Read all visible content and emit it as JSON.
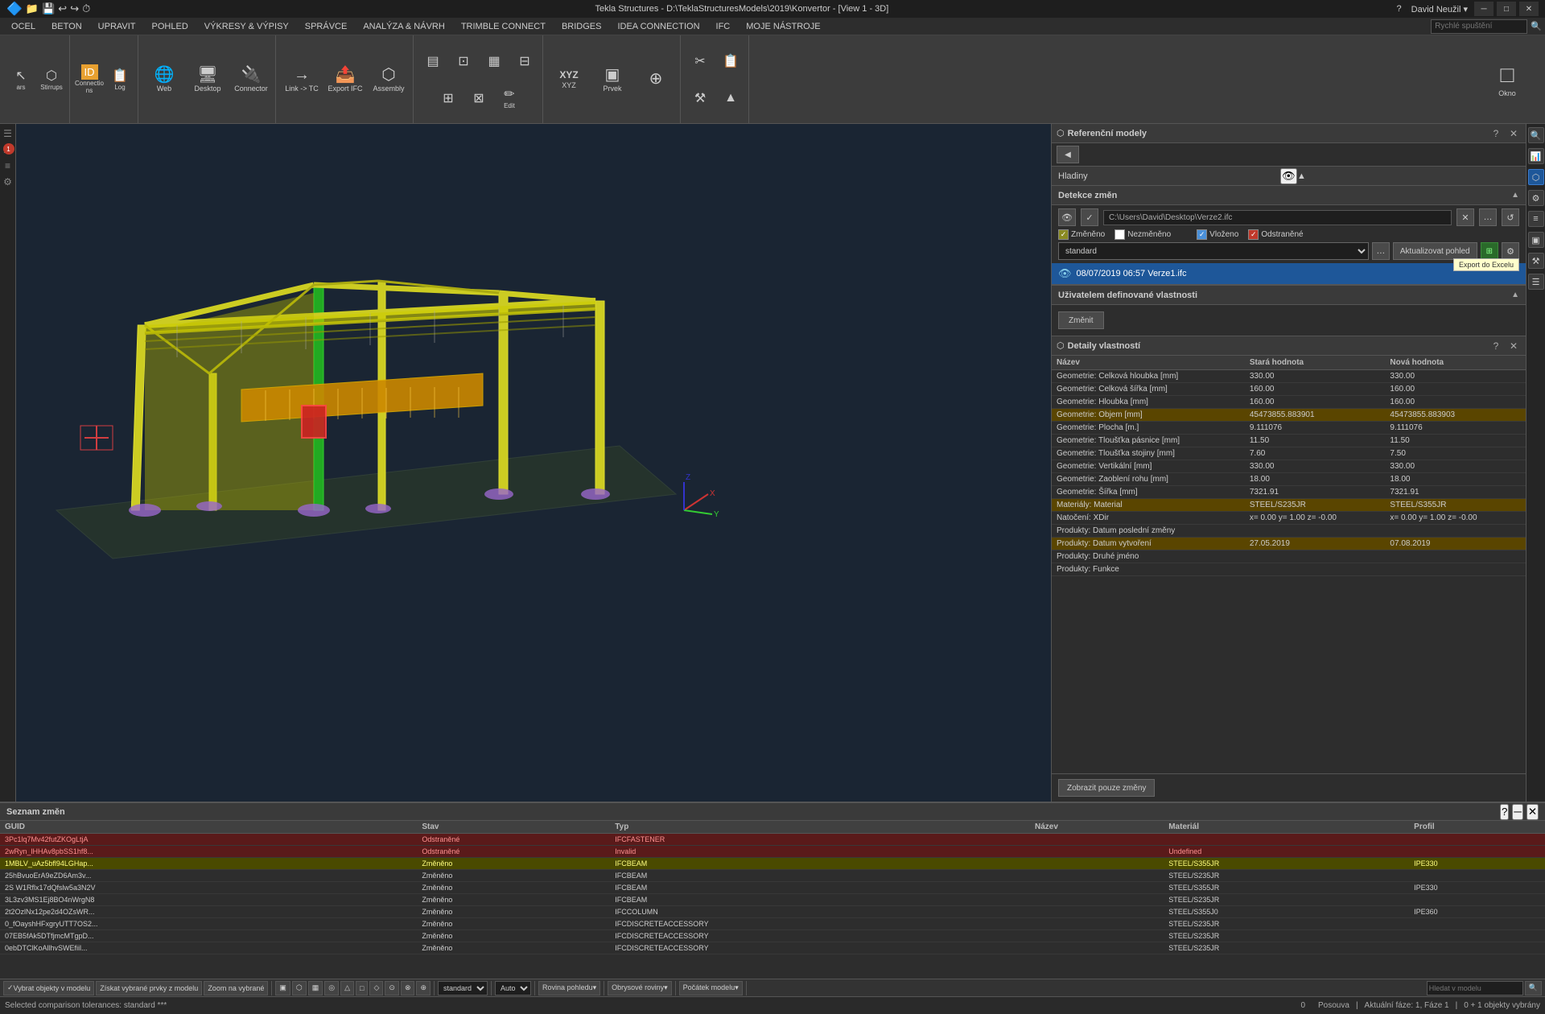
{
  "titlebar": {
    "title": "Tekla Structures - D:\\TeklaStructuresModels\\2019\\Konvertor - [View 1 - 3D]",
    "controls": [
      "?",
      "David Neužil ▾",
      "─",
      "□",
      "✕"
    ],
    "minimize": "─",
    "maximize": "□",
    "close": "✕"
  },
  "menubar": {
    "items": [
      "OCEL",
      "BETON",
      "UPRAVIT",
      "POHLED",
      "VÝKRESY & VÝPISY",
      "SPRÁVCE",
      "ANALÝZA & NÁVRH",
      "TRIMBLE CONNECT",
      "BRIDGES",
      "IDEA CONNECTION",
      "IFC",
      "MOJE NÁSTROJE"
    ]
  },
  "toolbar": {
    "groups": [
      {
        "tools": [
          {
            "icon": "↖",
            "label": "ars"
          },
          {
            "icon": "▣",
            "label": "Stirrups"
          }
        ]
      },
      {
        "tools": [
          {
            "icon": "ID",
            "label": "Connectio\nns"
          },
          {
            "icon": "📋",
            "label": "Log"
          }
        ]
      },
      {
        "tools": [
          {
            "icon": "🌐",
            "label": "Web"
          },
          {
            "icon": "🖥",
            "label": "Desktop"
          },
          {
            "icon": "🔌",
            "label": "Connector"
          }
        ]
      },
      {
        "tools": [
          {
            "icon": "→",
            "label": "Link -> TC"
          },
          {
            "icon": "📤",
            "label": "Export IFC"
          },
          {
            "icon": "⬡",
            "label": "Assembly"
          }
        ]
      },
      {
        "tools": [
          {
            "icon": "▤",
            "label": ""
          },
          {
            "icon": "⊡",
            "label": ""
          },
          {
            "icon": "⊞",
            "label": ""
          },
          {
            "icon": "⊟",
            "label": ""
          }
        ]
      },
      {
        "tools": [
          {
            "icon": "✏",
            "label": "Edit"
          }
        ]
      },
      {
        "tools": [
          {
            "icon": "XYZ",
            "label": "XYZ"
          },
          {
            "icon": "▣",
            "label": "Prvek"
          },
          {
            "icon": "⊕",
            "label": ""
          }
        ]
      }
    ],
    "rightTools": [
      "✂",
      "📋",
      "⚒",
      "▲"
    ]
  },
  "right_sidebar": {
    "buttons": [
      "?",
      "↗",
      "⚙",
      "👁",
      "⚙",
      "≡",
      "▣",
      "⚙"
    ]
  },
  "ref_models": {
    "title": "Referenční modely",
    "nav_btn": "◀",
    "hladiny": "Hladiny",
    "detection_title": "Detekce změn",
    "file_path": "C:\\Users\\David\\Desktop\\Verze2.ifc",
    "changed_label": "Změněno",
    "inserted_label": "Vloženo",
    "unchanged_label": "Nezměněno",
    "removed_label": "Odstraněné",
    "standard_option": "standard",
    "update_btn": "Aktualizovat pohled",
    "export_excel_tooltip": "Export do Excelu",
    "file_entry": "08/07/2019 06:57 Verze1.ifc",
    "user_props_title": "Uživatelem definované vlastnosti",
    "zmenit_btn": "Změnit"
  },
  "details": {
    "title": "Detaily vlastností",
    "columns": [
      "Název",
      "Stará hodnota",
      "Nová hodnota"
    ],
    "rows": [
      {
        "name": "Geometrie: Celková hloubka [mm]",
        "old": "330.00",
        "new": "330.00",
        "highlight": false
      },
      {
        "name": "Geometrie: Celková šířka [mm]",
        "old": "160.00",
        "new": "160.00",
        "highlight": false
      },
      {
        "name": "Geometrie: Hloubka [mm]",
        "old": "160.00",
        "new": "160.00",
        "highlight": false
      },
      {
        "name": "Geometrie: Objem [mm]",
        "old": "45473855.883901",
        "new": "45473855.883903",
        "highlight": true
      },
      {
        "name": "Geometrie: Plocha [m.]",
        "old": "9.111076",
        "new": "9.111076",
        "highlight": false
      },
      {
        "name": "Geometrie: Tloušťka pásnice [mm]",
        "old": "11.50",
        "new": "11.50",
        "highlight": false
      },
      {
        "name": "Geometrie: Tloušťka stojiny [mm]",
        "old": "7.60",
        "new": "7.50",
        "highlight": false
      },
      {
        "name": "Geometrie: Vertikální [mm]",
        "old": "330.00",
        "new": "330.00",
        "highlight": false
      },
      {
        "name": "Geometrie: Zaoblení rohu [mm]",
        "old": "18.00",
        "new": "18.00",
        "highlight": false
      },
      {
        "name": "Geometrie: Šířka [mm]",
        "old": "7321.91",
        "new": "7321.91",
        "highlight": false
      },
      {
        "name": "Materiály: Material",
        "old": "STEEL/S235JR",
        "new": "STEEL/S355JR",
        "highlight": true
      },
      {
        "name": "Natočení: XDir",
        "old": "x= 0.00 y= 1.00 z= -0.00",
        "new": "x= 0.00 y= 1.00 z= -0.00",
        "highlight": false
      },
      {
        "name": "Produkty: Datum poslední změny",
        "old": "",
        "new": "",
        "highlight": false
      },
      {
        "name": "Produkty: Datum vytvoření",
        "old": "27.05.2019",
        "new": "07.08.2019",
        "highlight": true
      },
      {
        "name": "Produkty: Druhé jméno",
        "old": "",
        "new": "",
        "highlight": false
      },
      {
        "name": "Produkty: Funkce",
        "old": "",
        "new": "",
        "highlight": false
      }
    ],
    "show_only_btn": "Zobrazit pouze změny"
  },
  "list": {
    "title": "Seznam změn",
    "columns": [
      "GUID",
      "Stav",
      "Typ",
      "Název",
      "Materiál",
      "Profil"
    ],
    "rows": [
      {
        "guid": "3Pc1lq7Mv42futZKOgLtjA",
        "stav": "Odstraněné",
        "typ": "IFCFASTENER",
        "nazev": "",
        "material": "",
        "profil": "",
        "row_class": "red-row"
      },
      {
        "guid": "2wRyn_lHHAv8pbSS1hf8...",
        "stav": "Odstraněné",
        "typ": "Invalid",
        "nazev": "",
        "material": "Undefined",
        "profil": "",
        "row_class": "red-row"
      },
      {
        "guid": "1MBLV_uAz5bfl94LGHap...",
        "stav": "Změněno",
        "typ": "IFCBEAM",
        "nazev": "",
        "material": "STEEL/S355JR",
        "profil": "IPE330",
        "row_class": "yellow-row"
      },
      {
        "guid": "25hBvuoErA9eZD6Am3v...",
        "stav": "Změněno",
        "typ": "IFCBEAM",
        "nazev": "",
        "material": "STEEL/S235JR",
        "profil": "",
        "row_class": ""
      },
      {
        "guid": "2S W1Rflx17dQfslw5a3N2V",
        "stav": "Změněno",
        "typ": "IFCBEAM",
        "nazev": "",
        "material": "STEEL/S355JR",
        "profil": "IPE330",
        "row_class": ""
      },
      {
        "guid": "3L3zv3MS1Ej8BO4nWrgN8",
        "stav": "Změněno",
        "typ": "IFCBEAM",
        "nazev": "",
        "material": "STEEL/S235JR",
        "profil": "",
        "row_class": ""
      },
      {
        "guid": "2t2OzlNx12pe2d4OZsWR...",
        "stav": "Změněno",
        "typ": "IFCCOLUMN",
        "nazev": "",
        "material": "STEEL/S355J0",
        "profil": "IPE360",
        "row_class": ""
      },
      {
        "guid": "0_fOayshHFxgryUTT7OS2...",
        "stav": "Změněno",
        "typ": "IFCDISCRETEACCESSORY",
        "nazev": "",
        "material": "STEEL/S235JR",
        "profil": "",
        "row_class": ""
      },
      {
        "guid": "07EB5fAk5DTfjmcMTgpD...",
        "stav": "Změněno",
        "typ": "IFCDISCRETEACCESSORY",
        "nazev": "",
        "material": "STEEL/S235JR",
        "profil": "",
        "row_class": ""
      },
      {
        "guid": "0ebDTClKoAllhvSWEfiil...",
        "stav": "Změněno",
        "typ": "IFCDISCRETEACCESSORY",
        "nazev": "",
        "material": "STEEL/S235JR",
        "profil": "",
        "row_class": ""
      }
    ]
  },
  "bottom_bar": {
    "buttons": [
      "Vybrat objekty v modelu",
      "Získat vybrané prvky z modelu",
      "Zoom na vybrané"
    ],
    "search_placeholder": "Hledat v modelu",
    "mode_options": [
      "standard",
      "Auto"
    ],
    "rovina": "Rovina pohledu▾",
    "obrysove": "Obrysové roviny▾",
    "pocatek": "Počátek modelu▾",
    "posouva": "Posouva",
    "aktualni": "Aktuální fáze: 1, Fáze 1",
    "objekty": "0 + 1 objekty vybrány"
  },
  "statusbar": {
    "text": "Selected comparison tolerances: standard ***"
  }
}
